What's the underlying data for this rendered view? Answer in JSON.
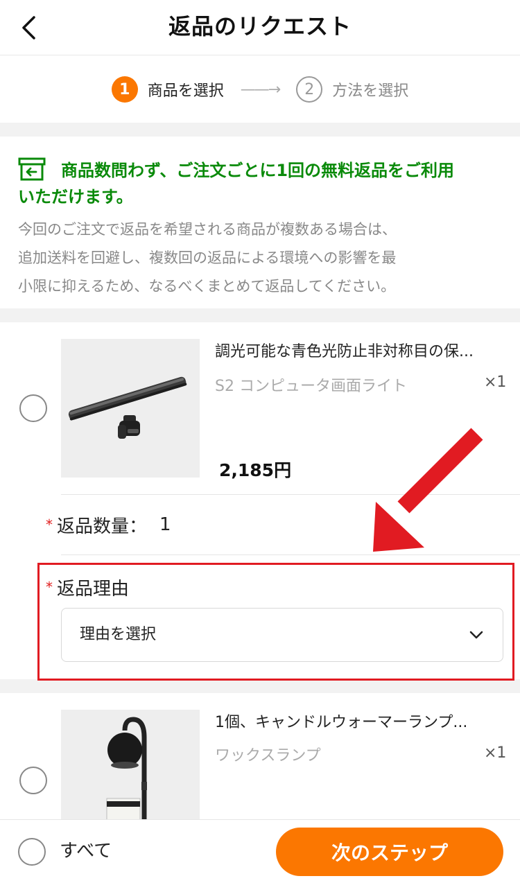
{
  "header": {
    "title": "返品のリクエスト"
  },
  "steps": [
    {
      "number": "1",
      "label": "商品を選択",
      "state": "active"
    },
    {
      "number": "2",
      "label": "方法を選択",
      "state": "inactive"
    }
  ],
  "steps_arrow": "——→",
  "notice": {
    "title_line1": "商品数問わず、ご注文ごとに1回の無料返品をご利用",
    "title_line2": "いただけます。",
    "body_line1": "今回のご注文で返品を希望される商品が複数ある場合は、",
    "body_line2": "追加送料を回避し、複数回の返品による環境への影響を最",
    "body_line3": "小限に抑えるため、なるべくまとめて返品してください。",
    "icon": "return-box-icon"
  },
  "products": [
    {
      "title": "調光可能な青色光防止非対称目の保...",
      "variant": "S2 コンピュータ画面ライト",
      "qty": "×1",
      "price": "2,185円"
    },
    {
      "title": "1個、キャンドルウォーマーランプ...",
      "variant": "ワックスランプ",
      "qty": "×1"
    }
  ],
  "return_quantity": {
    "required_mark": "*",
    "label": "返品数量：",
    "value": "1"
  },
  "return_reason": {
    "required_mark": "*",
    "label": "返品理由",
    "select_value": "理由を選択"
  },
  "bottom": {
    "all_label": "すべて",
    "next_button": "次のステップ"
  },
  "colors": {
    "accent": "#fb7701",
    "notice_green": "#0a8a0a",
    "highlight_red": "#e11b22"
  }
}
